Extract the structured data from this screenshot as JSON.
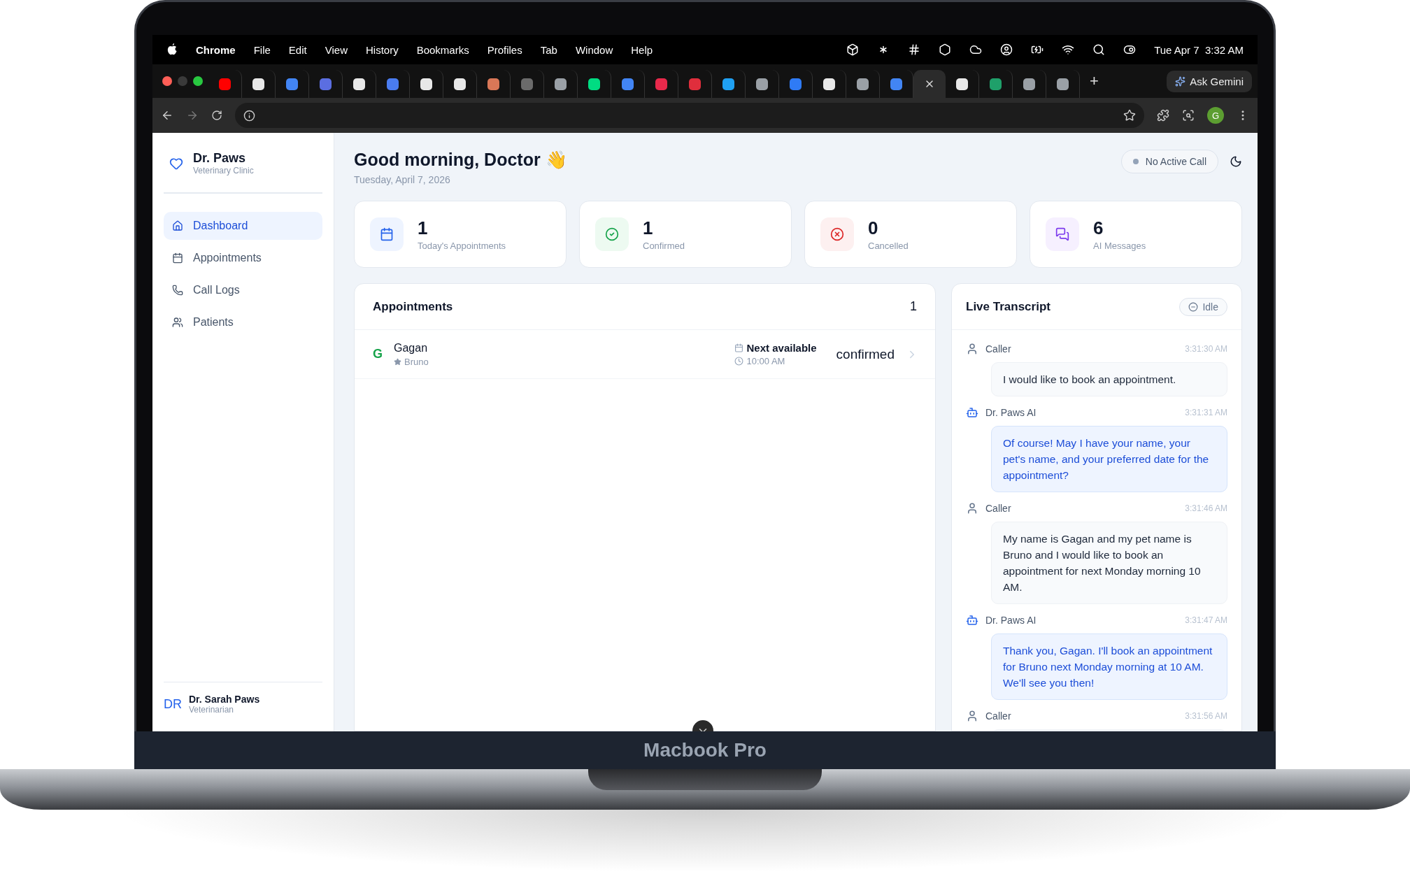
{
  "menu_bar": {
    "app": "Chrome",
    "items": [
      "File",
      "Edit",
      "View",
      "History",
      "Bookmarks",
      "Profiles",
      "Tab",
      "Window",
      "Help"
    ],
    "clock": "Tue Apr 7  3:32 AM"
  },
  "browser": {
    "tabs": [
      {
        "selected": false
      },
      {
        "selected": false
      },
      {
        "selected": false
      },
      {
        "selected": false
      },
      {
        "selected": false
      },
      {
        "selected": false
      },
      {
        "selected": false
      },
      {
        "selected": false
      },
      {
        "selected": false
      },
      {
        "selected": false
      },
      {
        "selected": false
      },
      {
        "selected": false
      },
      {
        "selected": false
      },
      {
        "selected": false
      },
      {
        "selected": false
      },
      {
        "selected": false
      },
      {
        "selected": false
      },
      {
        "selected": false
      },
      {
        "selected": false
      },
      {
        "selected": false
      },
      {
        "selected": false
      },
      {
        "selected": true
      },
      {
        "selected": false
      },
      {
        "selected": false
      },
      {
        "selected": false
      },
      {
        "selected": false
      }
    ],
    "new_tab": "+",
    "gemini": "Ask Gemini",
    "profile_initial": "G"
  },
  "sidebar": {
    "title": "Dr. Paws",
    "subtitle": "Veterinary Clinic",
    "items": [
      {
        "label": "Dashboard",
        "kind": "home",
        "selected": true
      },
      {
        "label": "Appointments",
        "kind": "calendar",
        "selected": false
      },
      {
        "label": "Call Logs",
        "kind": "phone",
        "selected": false
      },
      {
        "label": "Patients",
        "kind": "users",
        "selected": false
      }
    ],
    "user": {
      "initials": "DR",
      "name": "Dr. Sarah Paws",
      "role": "Veterinarian"
    }
  },
  "header": {
    "greeting": "Good morning, Doctor 👋",
    "date": "Tuesday, April 7, 2026",
    "call_status": "No Active Call"
  },
  "stats": [
    {
      "kind": "calendar",
      "value": "1",
      "label": "Today's Appointments"
    },
    {
      "kind": "confirmed",
      "value": "1",
      "label": "Confirmed"
    },
    {
      "kind": "cancelled",
      "value": "0",
      "label": "Cancelled"
    },
    {
      "kind": "messages",
      "value": "6",
      "label": "AI Messages"
    }
  ],
  "appointments": {
    "title": "Appointments",
    "count": "1",
    "rows": [
      {
        "initial": "G",
        "name": "Gagan",
        "pet": "Bruno",
        "date": "Next available",
        "time": "10:00 AM",
        "status": "confirmed"
      }
    ]
  },
  "transcript": {
    "title": "Live Transcript",
    "status": "Idle",
    "messages": [
      {
        "kind": "caller",
        "speaker": "Caller",
        "time": "3:31:30 AM",
        "text": "I would like to book an appointment."
      },
      {
        "kind": "ai",
        "speaker": "Dr. Paws AI",
        "time": "3:31:31 AM",
        "text": "Of course! May I have your name, your pet's name, and your preferred date for the appointment?"
      },
      {
        "kind": "caller",
        "speaker": "Caller",
        "time": "3:31:46 AM",
        "text": "My name is Gagan and my pet name is Bruno and I would like to book an appointment for next Monday morning 10 AM."
      },
      {
        "kind": "ai",
        "speaker": "Dr. Paws AI",
        "time": "3:31:47 AM",
        "text": "Thank you, Gagan. I'll book an appointment for Bruno next Monday morning at 10 AM. We'll see you then!"
      },
      {
        "kind": "caller",
        "speaker": "Caller",
        "time": "3:31:56 AM"
      }
    ]
  },
  "device_label": "Macbook Pro"
}
